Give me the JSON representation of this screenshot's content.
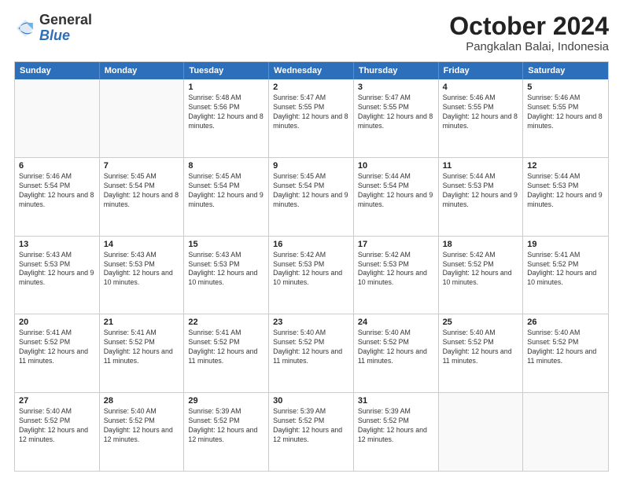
{
  "logo": {
    "line1": "General",
    "line2": "Blue"
  },
  "title": "October 2024",
  "subtitle": "Pangkalan Balai, Indonesia",
  "days_of_week": [
    "Sunday",
    "Monday",
    "Tuesday",
    "Wednesday",
    "Thursday",
    "Friday",
    "Saturday"
  ],
  "weeks": [
    [
      {
        "day": "",
        "info": "",
        "empty": true
      },
      {
        "day": "",
        "info": "",
        "empty": true
      },
      {
        "day": "1",
        "info": "Sunrise: 5:48 AM\nSunset: 5:56 PM\nDaylight: 12 hours and 8 minutes."
      },
      {
        "day": "2",
        "info": "Sunrise: 5:47 AM\nSunset: 5:55 PM\nDaylight: 12 hours and 8 minutes."
      },
      {
        "day": "3",
        "info": "Sunrise: 5:47 AM\nSunset: 5:55 PM\nDaylight: 12 hours and 8 minutes."
      },
      {
        "day": "4",
        "info": "Sunrise: 5:46 AM\nSunset: 5:55 PM\nDaylight: 12 hours and 8 minutes."
      },
      {
        "day": "5",
        "info": "Sunrise: 5:46 AM\nSunset: 5:55 PM\nDaylight: 12 hours and 8 minutes."
      }
    ],
    [
      {
        "day": "6",
        "info": "Sunrise: 5:46 AM\nSunset: 5:54 PM\nDaylight: 12 hours and 8 minutes."
      },
      {
        "day": "7",
        "info": "Sunrise: 5:45 AM\nSunset: 5:54 PM\nDaylight: 12 hours and 8 minutes."
      },
      {
        "day": "8",
        "info": "Sunrise: 5:45 AM\nSunset: 5:54 PM\nDaylight: 12 hours and 9 minutes."
      },
      {
        "day": "9",
        "info": "Sunrise: 5:45 AM\nSunset: 5:54 PM\nDaylight: 12 hours and 9 minutes."
      },
      {
        "day": "10",
        "info": "Sunrise: 5:44 AM\nSunset: 5:54 PM\nDaylight: 12 hours and 9 minutes."
      },
      {
        "day": "11",
        "info": "Sunrise: 5:44 AM\nSunset: 5:53 PM\nDaylight: 12 hours and 9 minutes."
      },
      {
        "day": "12",
        "info": "Sunrise: 5:44 AM\nSunset: 5:53 PM\nDaylight: 12 hours and 9 minutes."
      }
    ],
    [
      {
        "day": "13",
        "info": "Sunrise: 5:43 AM\nSunset: 5:53 PM\nDaylight: 12 hours and 9 minutes."
      },
      {
        "day": "14",
        "info": "Sunrise: 5:43 AM\nSunset: 5:53 PM\nDaylight: 12 hours and 10 minutes."
      },
      {
        "day": "15",
        "info": "Sunrise: 5:43 AM\nSunset: 5:53 PM\nDaylight: 12 hours and 10 minutes."
      },
      {
        "day": "16",
        "info": "Sunrise: 5:42 AM\nSunset: 5:53 PM\nDaylight: 12 hours and 10 minutes."
      },
      {
        "day": "17",
        "info": "Sunrise: 5:42 AM\nSunset: 5:53 PM\nDaylight: 12 hours and 10 minutes."
      },
      {
        "day": "18",
        "info": "Sunrise: 5:42 AM\nSunset: 5:52 PM\nDaylight: 12 hours and 10 minutes."
      },
      {
        "day": "19",
        "info": "Sunrise: 5:41 AM\nSunset: 5:52 PM\nDaylight: 12 hours and 10 minutes."
      }
    ],
    [
      {
        "day": "20",
        "info": "Sunrise: 5:41 AM\nSunset: 5:52 PM\nDaylight: 12 hours and 11 minutes."
      },
      {
        "day": "21",
        "info": "Sunrise: 5:41 AM\nSunset: 5:52 PM\nDaylight: 12 hours and 11 minutes."
      },
      {
        "day": "22",
        "info": "Sunrise: 5:41 AM\nSunset: 5:52 PM\nDaylight: 12 hours and 11 minutes."
      },
      {
        "day": "23",
        "info": "Sunrise: 5:40 AM\nSunset: 5:52 PM\nDaylight: 12 hours and 11 minutes."
      },
      {
        "day": "24",
        "info": "Sunrise: 5:40 AM\nSunset: 5:52 PM\nDaylight: 12 hours and 11 minutes."
      },
      {
        "day": "25",
        "info": "Sunrise: 5:40 AM\nSunset: 5:52 PM\nDaylight: 12 hours and 11 minutes."
      },
      {
        "day": "26",
        "info": "Sunrise: 5:40 AM\nSunset: 5:52 PM\nDaylight: 12 hours and 11 minutes."
      }
    ],
    [
      {
        "day": "27",
        "info": "Sunrise: 5:40 AM\nSunset: 5:52 PM\nDaylight: 12 hours and 12 minutes."
      },
      {
        "day": "28",
        "info": "Sunrise: 5:40 AM\nSunset: 5:52 PM\nDaylight: 12 hours and 12 minutes."
      },
      {
        "day": "29",
        "info": "Sunrise: 5:39 AM\nSunset: 5:52 PM\nDaylight: 12 hours and 12 minutes."
      },
      {
        "day": "30",
        "info": "Sunrise: 5:39 AM\nSunset: 5:52 PM\nDaylight: 12 hours and 12 minutes."
      },
      {
        "day": "31",
        "info": "Sunrise: 5:39 AM\nSunset: 5:52 PM\nDaylight: 12 hours and 12 minutes."
      },
      {
        "day": "",
        "info": "",
        "empty": true
      },
      {
        "day": "",
        "info": "",
        "empty": true
      }
    ]
  ]
}
